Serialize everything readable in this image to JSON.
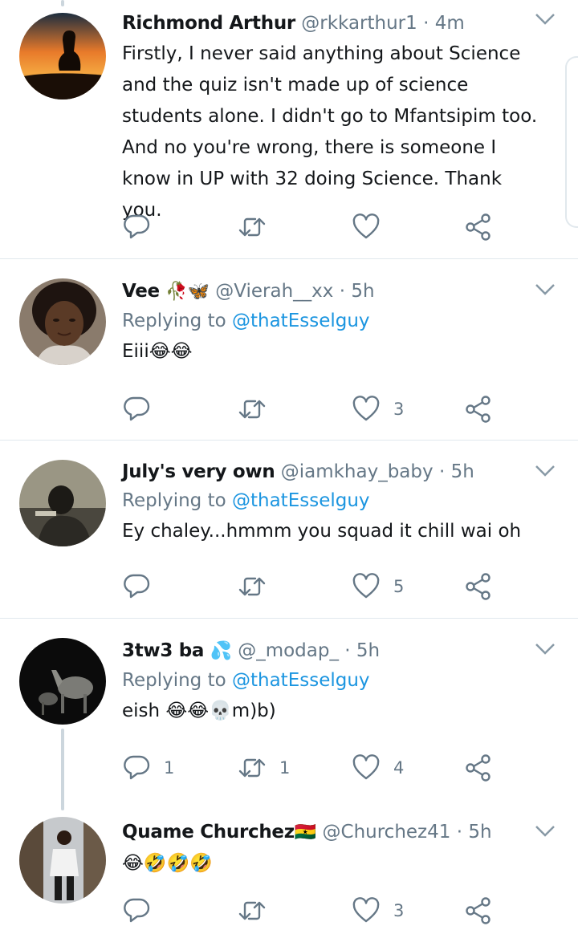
{
  "tweets": [
    {
      "name": "Richmond Arthur",
      "name_emoji": "",
      "handle": "@rkkarthur1",
      "time": "4m",
      "reply_prefix": "",
      "reply_to": "",
      "text": "Firstly, I never said anything about Science and the quiz isn't made up of science students alone. I didn't go to Mfantsipim too. And no you're wrong, there is someone I know in UP with 32 doing Science. Thank you.",
      "replies": "",
      "retweets": "",
      "likes": ""
    },
    {
      "name": "Vee",
      "name_emoji": "🥀🦋",
      "handle": "@Vierah__xx",
      "time": "5h",
      "reply_prefix": "Replying to",
      "reply_to": "@thatEsselguy",
      "text": "Eiii😂😂",
      "replies": "",
      "retweets": "",
      "likes": "3"
    },
    {
      "name": "July's very own",
      "name_emoji": "",
      "handle": "@iamkhay_baby",
      "time": "5h",
      "reply_prefix": "Replying to",
      "reply_to": "@thatEsselguy",
      "text": "Ey chaley...hmmm you squad it chill wai oh",
      "replies": "",
      "retweets": "",
      "likes": "5"
    },
    {
      "name": "3tw3 ba",
      "name_emoji": "💦",
      "handle": "@_modap_",
      "time": "5h",
      "reply_prefix": "Replying to",
      "reply_to": "@thatEsselguy",
      "text": "eish 😂😂💀m)b)",
      "replies": "1",
      "retweets": "1",
      "likes": "4"
    },
    {
      "name": "Quame Churchez",
      "name_emoji": "🇬🇭",
      "handle": "@Churchez41",
      "time": "5h",
      "reply_prefix": "",
      "reply_to": "",
      "text": "😂🤣🤣🤣",
      "replies": "",
      "retweets": "",
      "likes": "3"
    }
  ],
  "separator": "·",
  "icons": [
    "reply-icon",
    "retweet-icon",
    "like-icon",
    "share-icon",
    "chevron-down-icon"
  ],
  "colors": {
    "text": "#14171a",
    "secondary": "#657786",
    "link": "#1b95e0",
    "divider": "#e1e8ed"
  }
}
